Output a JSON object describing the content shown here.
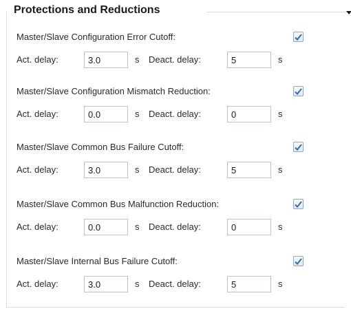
{
  "group": {
    "title": "Protections and Reductions"
  },
  "labels": {
    "act_delay": "Act. delay:",
    "deact_delay": "Deact. delay:",
    "unit": "s"
  },
  "sections": [
    {
      "label": "Master/Slave Configuration Error Cutoff:",
      "checked": true,
      "act_delay": "3.0",
      "deact_delay": "5"
    },
    {
      "label": "Master/Slave Configuration Mismatch Reduction:",
      "checked": true,
      "act_delay": "0.0",
      "deact_delay": "0"
    },
    {
      "label": "Master/Slave Common Bus Failure Cutoff:",
      "checked": true,
      "act_delay": "3.0",
      "deact_delay": "5"
    },
    {
      "label": "Master/Slave Common Bus Malfunction Reduction:",
      "checked": true,
      "act_delay": "0.0",
      "deact_delay": "0"
    },
    {
      "label": "Master/Slave Internal Bus Failure Cutoff:",
      "checked": true,
      "act_delay": "3.0",
      "deact_delay": "5"
    }
  ]
}
